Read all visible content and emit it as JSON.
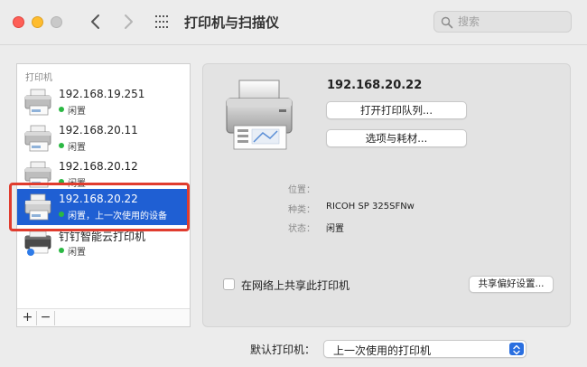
{
  "window": {
    "title": "打印机与扫描仪",
    "search_placeholder": "搜索"
  },
  "nav": {
    "back": "‹",
    "forward": "›"
  },
  "sidebar": {
    "header": "打印机",
    "printers": [
      {
        "name": "192.168.19.251",
        "status": "闲置"
      },
      {
        "name": "192.168.20.11",
        "status": "闲置"
      },
      {
        "name": "192.168.20.12",
        "status": "闲置"
      },
      {
        "name": "192.168.20.22",
        "status": "闲置，上一次使用的设备"
      },
      {
        "name": "钉钉智能云打印机",
        "status": "闲置"
      }
    ],
    "add_label": "+",
    "remove_label": "−"
  },
  "detail": {
    "name": "192.168.20.22",
    "open_queue_label": "打开打印队列...",
    "options_label": "选项与耗材...",
    "location_label": "位置：",
    "location_value": "",
    "kind_label": "种类：",
    "kind_value": "RICOH SP 325SFNw",
    "status_label": "状态：",
    "status_value": "闲置",
    "share_label": "在网络上共享此打印机",
    "share_prefs_label": "共享偏好设置..."
  },
  "footer": {
    "default_printer_label": "默认打印机：",
    "default_printer_value": "上一次使用的打印机"
  },
  "colors": {
    "selection": "#1f5fd3",
    "status_green": "#2bb843",
    "highlight_red": "#e03c2e"
  }
}
